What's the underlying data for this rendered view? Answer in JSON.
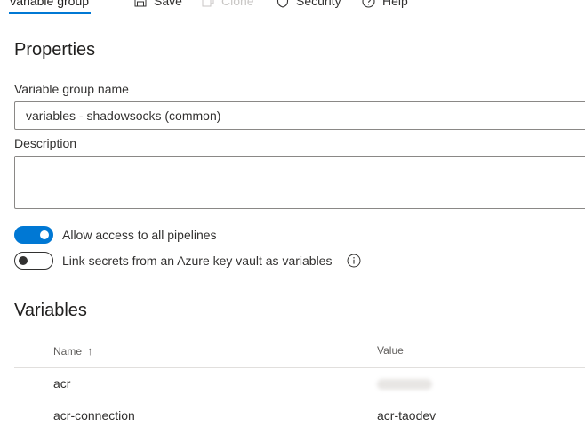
{
  "toolbar": {
    "active_tab": "Variable group",
    "save_label": "Save",
    "clone_label": "Clone",
    "security_label": "Security",
    "help_label": "Help"
  },
  "properties": {
    "heading": "Properties",
    "group_name_label": "Variable group name",
    "group_name_value": "variables - shadowsocks (common)",
    "description_label": "Description",
    "description_value": "",
    "allow_access_label": "Allow access to all pipelines",
    "allow_access_enabled": true,
    "link_secrets_label": "Link secrets from an Azure key vault as variables",
    "link_secrets_enabled": false
  },
  "variables": {
    "heading": "Variables",
    "columns": {
      "name": "Name",
      "value": "Value",
      "sort_indicator": "↑"
    },
    "rows": [
      {
        "name": "acr",
        "value": "",
        "secret": true
      },
      {
        "name": "acr-connection",
        "value": "acr-taodev",
        "secret": false
      }
    ]
  },
  "colors": {
    "accent": "#0078d4",
    "text": "#323130",
    "border": "#8a8886",
    "divider": "#e1dfdd",
    "disabled": "#c8c6c4"
  },
  "icons": {
    "save": "save-icon",
    "clone": "clone-icon",
    "security": "shield-icon",
    "help": "help-icon",
    "info": "info-icon",
    "sort": "sort-up-arrow-icon"
  }
}
